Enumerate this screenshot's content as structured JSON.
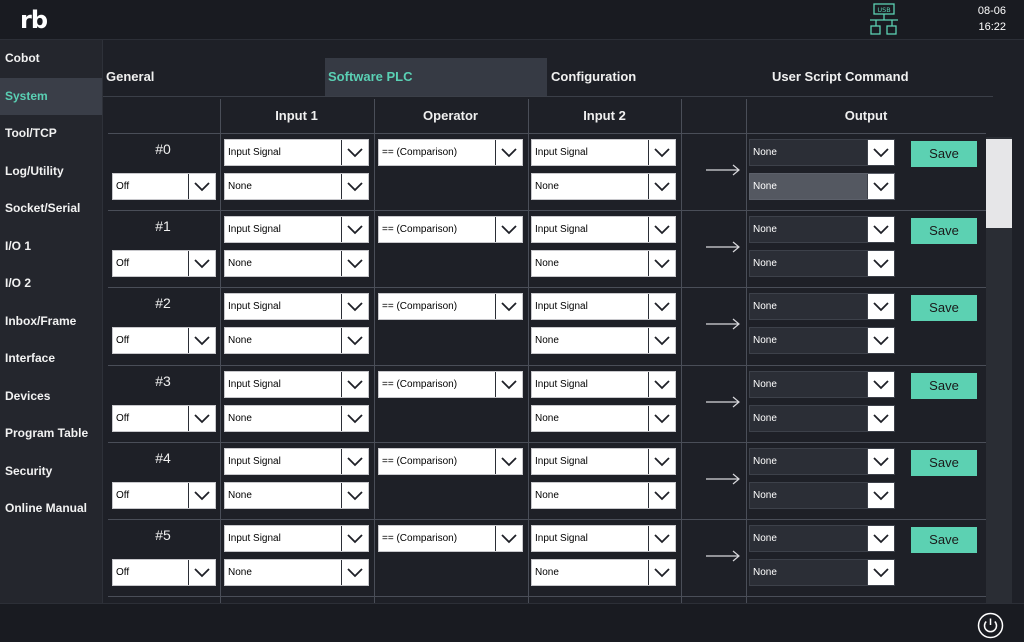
{
  "header": {
    "logo": "rb",
    "usb_label": "USB",
    "date": "08-06",
    "time": "16:22"
  },
  "sidebar": {
    "active": "System",
    "items": [
      {
        "label": "Cobot"
      },
      {
        "label": "System"
      },
      {
        "label": "Tool/TCP"
      },
      {
        "label": "Log/Utility"
      },
      {
        "label": "Socket/Serial"
      },
      {
        "label": "I/O 1"
      },
      {
        "label": "I/O 2"
      },
      {
        "label": "Inbox/Frame"
      },
      {
        "label": "Interface"
      },
      {
        "label": "Devices"
      },
      {
        "label": "Program Table"
      },
      {
        "label": "Security"
      },
      {
        "label": "Online Manual"
      }
    ]
  },
  "tabs": {
    "active": "Software PLC",
    "items": [
      {
        "label": "General"
      },
      {
        "label": "Software PLC"
      },
      {
        "label": "Configuration"
      },
      {
        "label": "User Script Command"
      }
    ]
  },
  "table": {
    "headers": [
      "Input 1",
      "Operator",
      "Input 2",
      "Output"
    ],
    "save_label": "Save",
    "rows": [
      {
        "index": "#0",
        "enable": "Off",
        "input1_type": "Input Signal",
        "input1_value": "None",
        "operator": "== (Comparison)",
        "input2_type": "Input Signal",
        "input2_value": "None",
        "output_type": "None",
        "output_value": "None"
      },
      {
        "index": "#1",
        "enable": "Off",
        "input1_type": "Input Signal",
        "input1_value": "None",
        "operator": "== (Comparison)",
        "input2_type": "Input Signal",
        "input2_value": "None",
        "output_type": "None",
        "output_value": "None"
      },
      {
        "index": "#2",
        "enable": "Off",
        "input1_type": "Input Signal",
        "input1_value": "None",
        "operator": "== (Comparison)",
        "input2_type": "Input Signal",
        "input2_value": "None",
        "output_type": "None",
        "output_value": "None"
      },
      {
        "index": "#3",
        "enable": "Off",
        "input1_type": "Input Signal",
        "input1_value": "None",
        "operator": "== (Comparison)",
        "input2_type": "Input Signal",
        "input2_value": "None",
        "output_type": "None",
        "output_value": "None"
      },
      {
        "index": "#4",
        "enable": "Off",
        "input1_type": "Input Signal",
        "input1_value": "None",
        "operator": "== (Comparison)",
        "input2_type": "Input Signal",
        "input2_value": "None",
        "output_type": "None",
        "output_value": "None"
      },
      {
        "index": "#5",
        "enable": "Off",
        "input1_type": "Input Signal",
        "input1_value": "None",
        "operator": "== (Comparison)",
        "input2_type": "Input Signal",
        "input2_value": "None",
        "output_type": "None",
        "output_value": "None"
      }
    ]
  },
  "colors": {
    "accent": "#5cd1b2",
    "background": "#1e2027",
    "sidebar": "#24262d"
  },
  "icons": {
    "usb": "usb-network-icon",
    "power": "power-icon",
    "chevron": "chevron-down-icon",
    "arrow": "arrow-right-icon"
  }
}
